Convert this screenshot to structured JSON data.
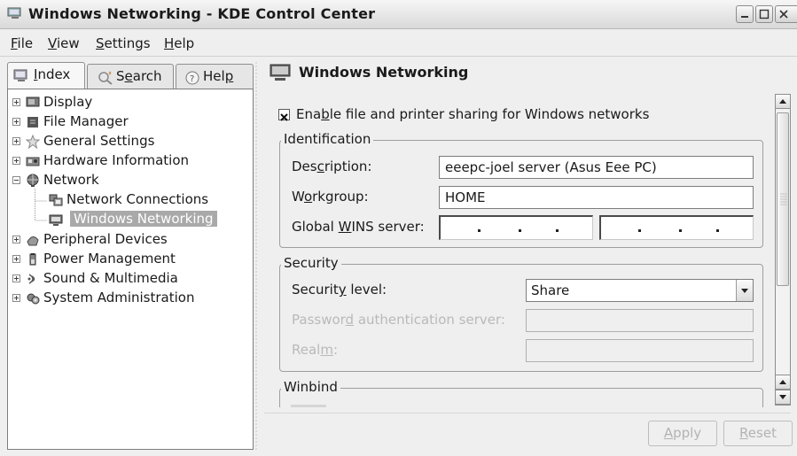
{
  "window": {
    "title": "Windows Networking - KDE Control Center"
  },
  "menubar": {
    "file": {
      "mnemonic": "F",
      "rest": "ile"
    },
    "view": {
      "mnemonic": "V",
      "rest": "iew"
    },
    "settings": {
      "mnemonic": "S",
      "rest": "ettings"
    },
    "help": {
      "mnemonic": "H",
      "rest": "elp"
    }
  },
  "tabs": {
    "index": {
      "mnemonic": "I",
      "rest": "ndex"
    },
    "search": {
      "pre": "S",
      "mnemonic": "e",
      "rest": "arch"
    },
    "help": {
      "pre": "Hel",
      "mnemonic": "p",
      "rest": ""
    }
  },
  "tree": {
    "items": [
      {
        "label": "Display",
        "icon": "display-icon"
      },
      {
        "label": "File Manager",
        "icon": "file-manager-icon"
      },
      {
        "label": "General Settings",
        "icon": "star-icon"
      },
      {
        "label": "Hardware Information",
        "icon": "hardware-icon"
      },
      {
        "label": "Network",
        "icon": "network-icon"
      },
      {
        "label": "Network Connections",
        "icon": "network-connections-icon"
      },
      {
        "label": "Windows Networking",
        "icon": "windows-networking-icon"
      },
      {
        "label": "Peripheral Devices",
        "icon": "peripheral-icon"
      },
      {
        "label": "Power Management",
        "icon": "power-icon"
      },
      {
        "label": "Sound & Multimedia",
        "icon": "sound-icon"
      },
      {
        "label": "System Administration",
        "icon": "system-admin-icon"
      }
    ]
  },
  "panel": {
    "heading": "Windows Networking",
    "enable_sharing": {
      "pre": "Ena",
      "mnemonic": "b",
      "rest": "le file and printer sharing for Windows networks",
      "checked": true
    },
    "identification": {
      "title": "Identification",
      "description_label": {
        "pre": "Des",
        "mnemonic": "c",
        "rest": "ription:"
      },
      "description_value": "eeepc-joel server (Asus Eee PC)",
      "workgroup_label": {
        "pre": "W",
        "mnemonic": "o",
        "rest": "rkgroup:"
      },
      "workgroup_value": "HOME",
      "wins_label": {
        "pre": "Global ",
        "mnemonic": "W",
        "rest": "INS server:"
      }
    },
    "security": {
      "title": "Security",
      "level_label": {
        "pre": "Securit",
        "mnemonic": "y",
        "rest": " level:"
      },
      "level_value": "Share",
      "password_server_label": {
        "pre": "Passwor",
        "mnemonic": "d",
        "rest": " authentication server:"
      },
      "realm_label": {
        "pre": "Real",
        "mnemonic": "m",
        "rest": ":"
      }
    },
    "winbind": {
      "title": "Winbind"
    }
  },
  "buttons": {
    "apply": {
      "mnemonic": "A",
      "rest": "pply"
    },
    "reset": {
      "mnemonic": "R",
      "rest": "eset"
    }
  }
}
